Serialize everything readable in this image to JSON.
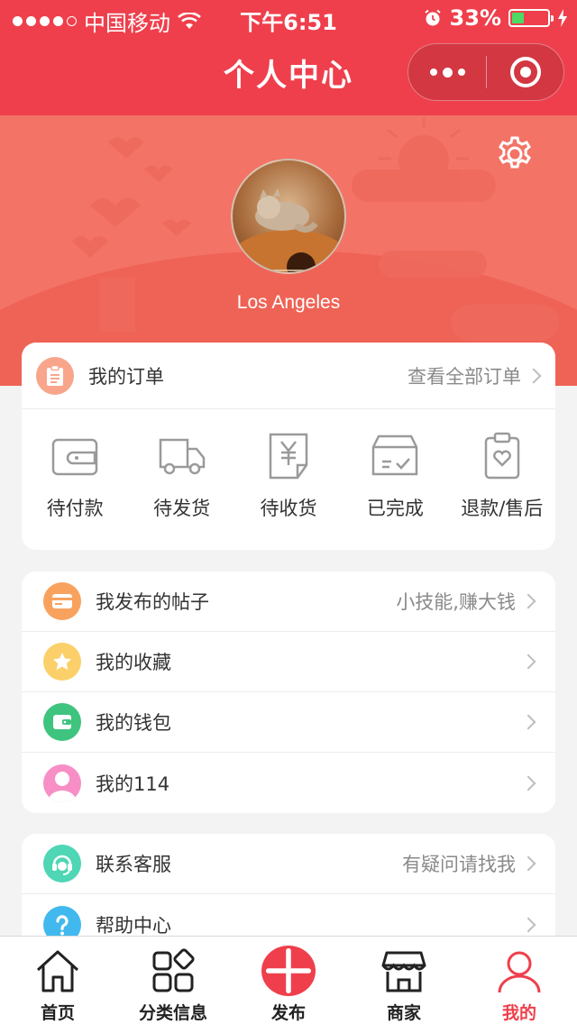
{
  "status_bar": {
    "carrier": "中国移动",
    "time": "下午6:51",
    "battery_percent": "33%",
    "battery_level": 0.33
  },
  "nav": {
    "title": "个人中心",
    "more_icon": "more-dots-icon",
    "close_icon": "target-close-icon"
  },
  "profile": {
    "city": "Los Angeles",
    "settings_icon": "gear-icon"
  },
  "orders": {
    "title": "我的订单",
    "view_all": "查看全部订单",
    "items": [
      {
        "label": "待付款",
        "icon": "wallet-icon"
      },
      {
        "label": "待发货",
        "icon": "truck-icon"
      },
      {
        "label": "待收货",
        "icon": "receipt-yuan-icon"
      },
      {
        "label": "已完成",
        "icon": "box-check-icon"
      },
      {
        "label": "退款/售后",
        "icon": "clipboard-heart-icon"
      }
    ]
  },
  "menu1": [
    {
      "label": "我发布的帖子",
      "right": "小技能,赚大钱",
      "icon": "card-icon",
      "color": "#f8a25e"
    },
    {
      "label": "我的收藏",
      "right": "",
      "icon": "star-icon",
      "color": "#fbd06a"
    },
    {
      "label": "我的钱包",
      "right": "",
      "icon": "wallet-icon",
      "color": "#3ec47e"
    },
    {
      "label": "我的114",
      "right": "",
      "icon": "user-icon",
      "color": "#f78fc6"
    }
  ],
  "menu2": [
    {
      "label": "联系客服",
      "right": "有疑问请找我",
      "icon": "headset-icon",
      "color": "#4fd6b4"
    },
    {
      "label": "帮助中心",
      "right": "",
      "icon": "question-icon",
      "color": "#41b9ee"
    }
  ],
  "tabbar": [
    {
      "label": "首页",
      "icon": "home-icon"
    },
    {
      "label": "分类信息",
      "icon": "category-icon"
    },
    {
      "label": "发布",
      "icon": "plus-icon"
    },
    {
      "label": "商家",
      "icon": "store-icon"
    },
    {
      "label": "我的",
      "icon": "user-icon",
      "active": true
    }
  ],
  "colors": {
    "brand": "#ef3f4c",
    "banner": "#f37367"
  }
}
